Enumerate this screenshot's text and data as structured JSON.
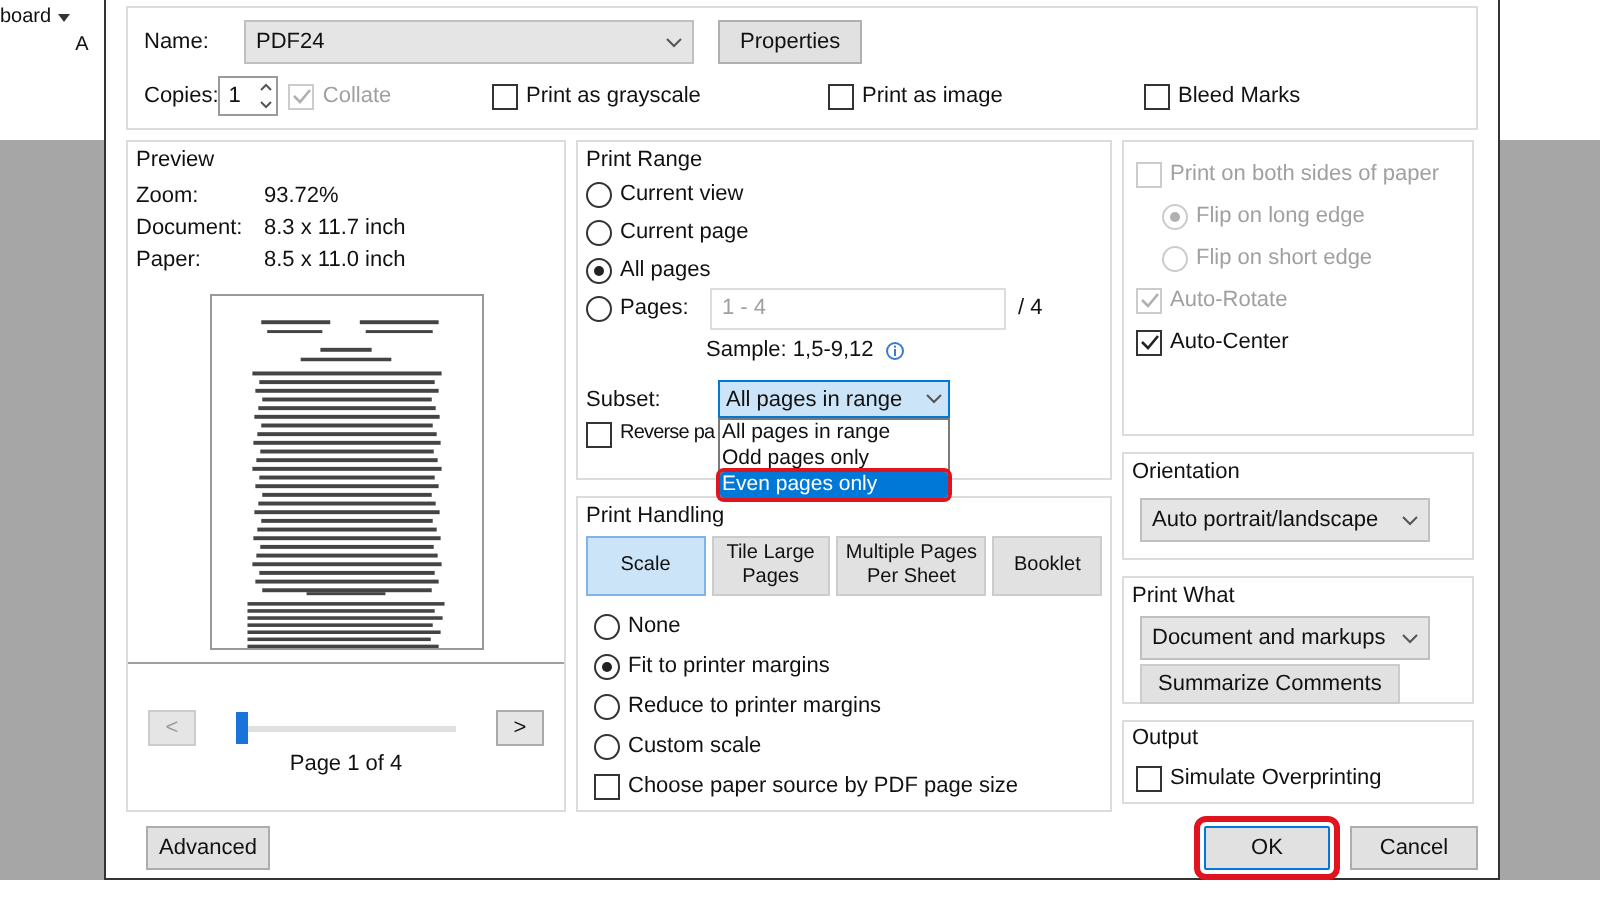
{
  "background_app": {
    "ribbon_label": "board",
    "ribbon_letter": "A"
  },
  "printer": {
    "label": "Name:",
    "value": "PDF24",
    "properties_button": "Properties"
  },
  "copies": {
    "label": "Copies:",
    "value": "1",
    "collate": {
      "label": "Collate",
      "checked": true,
      "disabled": true
    }
  },
  "top_options": [
    {
      "label": "Print as grayscale",
      "checked": false
    },
    {
      "label": "Print as image",
      "checked": false
    },
    {
      "label": "Bleed Marks",
      "checked": false
    }
  ],
  "preview": {
    "title": "Preview",
    "info": [
      {
        "label": "Zoom:",
        "value": "93.72%"
      },
      {
        "label": "Document:",
        "value": "8.3 x 11.7 inch"
      },
      {
        "label": "Paper:",
        "value": "8.5 x 11.0 inch"
      }
    ],
    "prev_button": "<",
    "next_button": ">",
    "slider": {
      "level": 0
    },
    "page_label": "Page 1 of 4"
  },
  "print_range": {
    "title": "Print Range",
    "options": [
      {
        "label": "Current view",
        "selected": false
      },
      {
        "label": "Current page",
        "selected": false
      },
      {
        "label": "All pages",
        "selected": true
      },
      {
        "label": "Pages:",
        "selected": false
      }
    ],
    "pages_value": "1 - 4",
    "pages_total": "/ 4",
    "sample": "Sample: 1,5-9,12",
    "subset_label": "Subset:",
    "subset_value": "All pages in range",
    "subset_options": [
      {
        "label": "All pages in range",
        "selected": false,
        "highlighted": false
      },
      {
        "label": "Odd pages only",
        "selected": false,
        "highlighted": false
      },
      {
        "label": "Even pages only",
        "selected": true,
        "highlighted": true
      }
    ],
    "reverse": {
      "label": "Reverse pa",
      "checked": false
    }
  },
  "print_handling": {
    "title": "Print Handling",
    "tabs": [
      {
        "label": "Scale",
        "selected": true
      },
      {
        "label": "Tile Large Pages",
        "selected": false
      },
      {
        "label": "Multiple Pages Per Sheet",
        "selected": false
      },
      {
        "label": "Booklet",
        "selected": false
      }
    ],
    "options": [
      {
        "label": "None",
        "selected": false
      },
      {
        "label": "Fit to printer margins",
        "selected": true
      },
      {
        "label": "Reduce to printer margins",
        "selected": false
      },
      {
        "label": "Custom scale",
        "selected": false
      }
    ],
    "paper_source": {
      "label": "Choose paper source by PDF page size",
      "checked": false
    }
  },
  "duplex": {
    "both_sides": {
      "label": "Print on both sides of paper",
      "checked": false,
      "disabled": true
    },
    "flip": [
      {
        "label": "Flip on long edge",
        "selected": true,
        "disabled": true
      },
      {
        "label": "Flip on short edge",
        "selected": false,
        "disabled": true
      }
    ],
    "auto_rotate": {
      "label": "Auto-Rotate",
      "checked": true,
      "disabled": true
    },
    "auto_center": {
      "label": "Auto-Center",
      "checked": true,
      "disabled": false
    }
  },
  "orientation": {
    "title": "Orientation",
    "value": "Auto portrait/landscape"
  },
  "print_what": {
    "title": "Print What",
    "value": "Document and markups",
    "button": "Summarize Comments"
  },
  "output": {
    "title": "Output",
    "simulate": {
      "label": "Simulate Overprinting",
      "checked": false
    }
  },
  "buttons": [
    {
      "label": "Advanced",
      "highlighted": false
    },
    {
      "label": "OK",
      "highlighted": true
    },
    {
      "label": "Cancel",
      "highlighted": false
    }
  ]
}
